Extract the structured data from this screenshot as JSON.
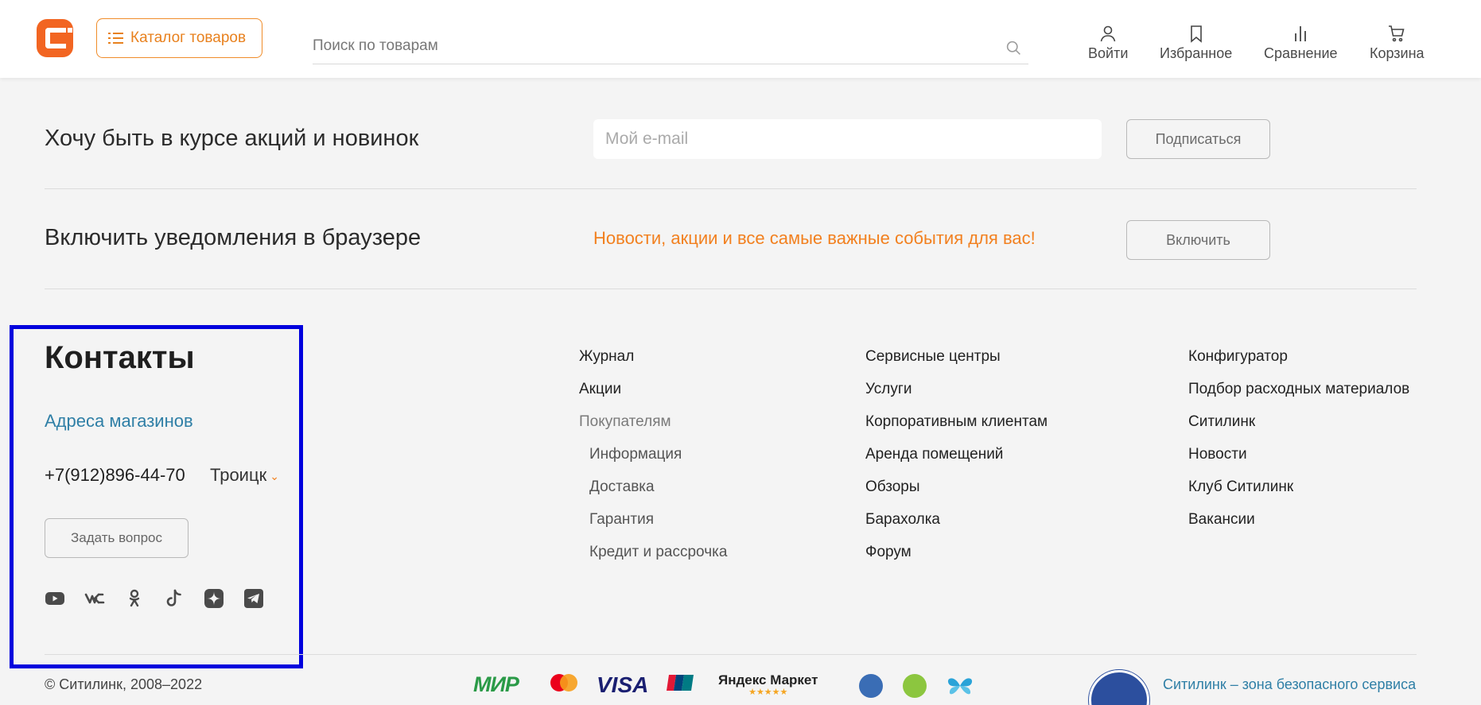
{
  "header": {
    "catalog_label": "Каталог товаров",
    "search_placeholder": "Поиск по товарам",
    "login_label": "Войти",
    "favorites_label": "Избранное",
    "compare_label": "Сравнение",
    "cart_label": "Корзина",
    "accent_color": "#f26522"
  },
  "subscribe": {
    "title": "Хочу быть в курсе акций и новинок",
    "email_placeholder": "Мой e-mail",
    "button_label": "Подписаться"
  },
  "notifications": {
    "title": "Включить уведомления в браузере",
    "text": "Новости, акции и все самые важные события для вас!",
    "button_label": "Включить"
  },
  "contacts": {
    "title": "Контакты",
    "addresses_link": "Адреса магазинов",
    "phone": "+7(912)896-44-70",
    "city": "Троицк",
    "ask_button": "Задать вопрос",
    "socials": [
      "youtube-icon",
      "vk-icon",
      "odnoklassniki-icon",
      "tiktok-icon",
      "zen-icon",
      "telegram-icon"
    ],
    "highlight_color": "#0000dd"
  },
  "links": {
    "col1": [
      {
        "label": "Журнал",
        "kind": "link"
      },
      {
        "label": "Акции",
        "kind": "link"
      },
      {
        "label": "Покупателям",
        "kind": "heading"
      },
      {
        "label": "Информация",
        "kind": "sub"
      },
      {
        "label": "Доставка",
        "kind": "sub"
      },
      {
        "label": "Гарантия",
        "kind": "sub"
      },
      {
        "label": "Кредит и рассрочка",
        "kind": "sub"
      }
    ],
    "col2": [
      "Сервисные центры",
      "Услуги",
      "Корпоративным клиентам",
      "Аренда помещений",
      "Обзоры",
      "Барахолка",
      "Форум"
    ],
    "col3": [
      "Конфигуратор",
      "Подбор расходных материалов",
      "Ситилинк",
      "Новости",
      "Клуб Ситилинк",
      "Вакансии"
    ]
  },
  "footer": {
    "copyright": "© Ситилинк, 2008–2022",
    "payments": {
      "mir": "МИР",
      "visa": "VISA",
      "yandex": "Яндекс Маркет",
      "yandex_stars": "★★★★★"
    },
    "safe_service": "Ситилинк – зона безопасного сервиса"
  }
}
